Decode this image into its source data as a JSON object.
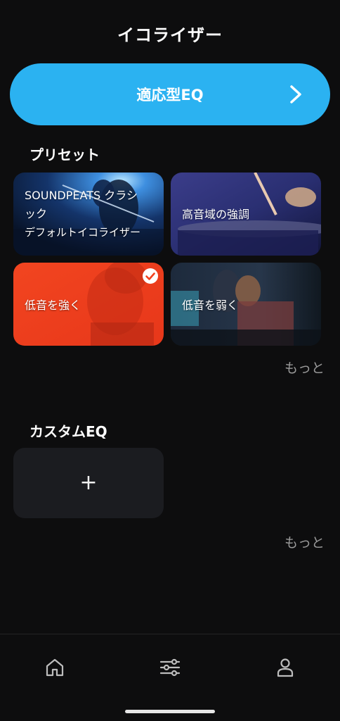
{
  "header": {
    "title": "イコライザー"
  },
  "adaptive_eq": {
    "label": "適応型EQ"
  },
  "presets": {
    "section_title": "プリセット",
    "items": [
      {
        "title": "SOUNDPEATS クラシック",
        "title_line1": "SOUNDPEATS クラシ",
        "title_line2": "ック",
        "subtitle": "デフォルトイコライザー"
      },
      {
        "title": "高音域の強調"
      },
      {
        "title": "低音を強く",
        "selected": true
      },
      {
        "title": "低音を弱く"
      }
    ],
    "more_label": "もっと"
  },
  "custom_eq": {
    "section_title": "カスタムEQ",
    "add_label": "+",
    "more_label": "もっと"
  },
  "bottom_nav": {
    "items": [
      {
        "icon": "home-icon"
      },
      {
        "icon": "equalizer-sliders-icon"
      },
      {
        "icon": "profile-icon"
      }
    ]
  },
  "colors": {
    "background": "#0d0d0e",
    "accent": "#2bb2f1",
    "card_bass_boost": "#f2421f",
    "muted_text": "#9a9a9a"
  }
}
